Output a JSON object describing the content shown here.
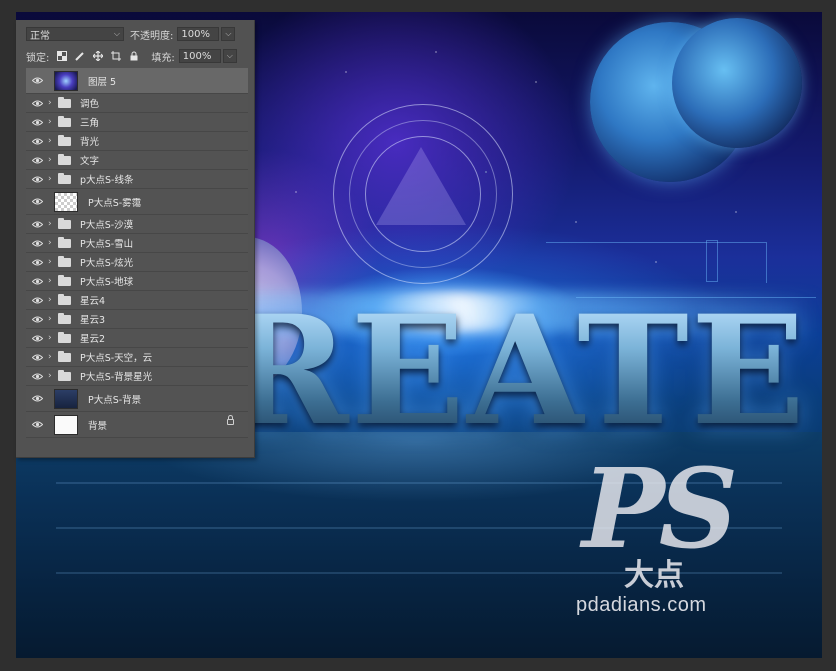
{
  "panel": {
    "blend_mode": "正常",
    "opacity_label": "不透明度:",
    "opacity_value": "100%",
    "lock_label": "锁定:",
    "fill_label": "填充:",
    "fill_value": "100%",
    "lock_icons": [
      "lock-transparent-pixels-icon",
      "lock-image-pixels-icon",
      "lock-position-icon",
      "lock-artboard-icon",
      "lock-all-icon"
    ]
  },
  "layers": [
    {
      "name": "图层 5",
      "type": "image",
      "thumb": "space",
      "selected": true
    },
    {
      "name": "调色",
      "type": "group"
    },
    {
      "name": "三角",
      "type": "group"
    },
    {
      "name": "背光",
      "type": "group"
    },
    {
      "name": "文字",
      "type": "group"
    },
    {
      "name": "p大点S-线条",
      "type": "group"
    },
    {
      "name": "P大点S-雾霭",
      "type": "image",
      "thumb": "transparent"
    },
    {
      "name": "P大点S-沙漠",
      "type": "group"
    },
    {
      "name": "P大点S-雪山",
      "type": "group"
    },
    {
      "name": "P大点S-炫光",
      "type": "group"
    },
    {
      "name": "P大点S-地球",
      "type": "group"
    },
    {
      "name": "星云4",
      "type": "group"
    },
    {
      "name": "星云3",
      "type": "group"
    },
    {
      "name": "星云2",
      "type": "group"
    },
    {
      "name": "P大点S-天空，云",
      "type": "group"
    },
    {
      "name": "P大点S-背景星光",
      "type": "group"
    },
    {
      "name": "P大点S-背景",
      "type": "image",
      "thumb": "dark"
    },
    {
      "name": "背景",
      "type": "background",
      "thumb": "white",
      "locked": true
    }
  ],
  "canvas": {
    "headline": "REATE"
  },
  "watermark": {
    "logo": "PS",
    "cn": "大点",
    "url": "pdadians.com"
  },
  "colors": {
    "app_bg": "#2f2f2f",
    "panel_bg": "#525252",
    "selected_row": "#686868"
  }
}
